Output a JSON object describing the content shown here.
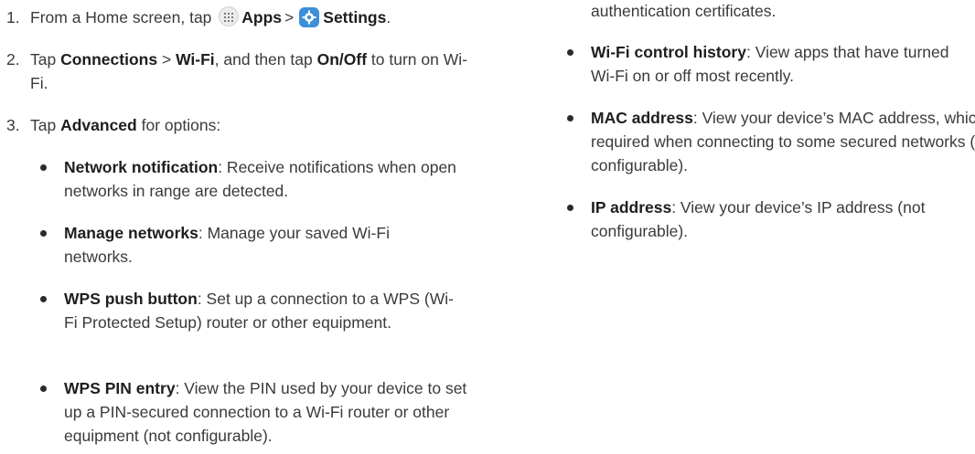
{
  "steps": [
    {
      "num": "1.",
      "pre": "From a Home screen, tap",
      "apps_label": "Apps",
      "sep": ">",
      "settings_label": "Settings",
      "post": "."
    },
    {
      "num": "2.",
      "pre": "Tap",
      "connections_label": "Connections",
      "sep": ">",
      "wifi_label": "Wi-Fi",
      "mid": ", and then tap",
      "onoff_label": "On/Off",
      "post": "to turn on Wi-Fi."
    },
    {
      "num": "3.",
      "pre": "Tap",
      "advanced_label": "Advanced",
      "post": "for options:"
    }
  ],
  "left_bullets": [
    {
      "term": "Network notification",
      "desc": ": Receive notifications when open networks in range are detected."
    },
    {
      "term": "Manage networks",
      "desc": ": Manage your saved Wi-Fi networks."
    },
    {
      "term": "WPS push button",
      "desc": ": Set up a connection to a WPS (Wi-Fi Protected Setup) router or other equipment."
    },
    {
      "term": "WPS PIN entry",
      "desc": ": View the PIN used by your device to set up a PIN-secured connection to a Wi-Fi router or other equipment (not configurable)."
    }
  ],
  "right_top_text": "authentication certificates.",
  "right_bullets": [
    {
      "term": "Wi-Fi control history",
      "desc": ": View apps that have turned Wi-Fi on or off most recently."
    },
    {
      "term": "MAC address",
      "desc": ": View your device’s MAC address, which is required when connecting to some secured networks (not configurable)."
    },
    {
      "term": "IP address",
      "desc": ": View your device’s IP address (not configurable)."
    }
  ]
}
